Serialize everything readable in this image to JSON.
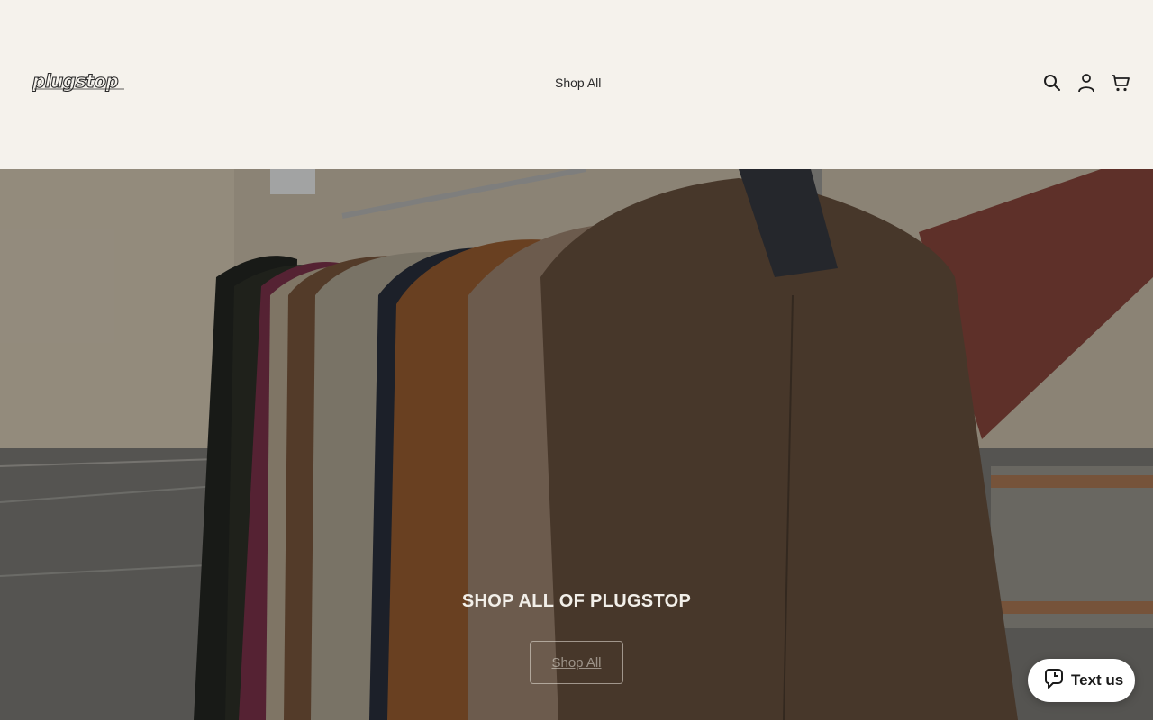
{
  "header": {
    "logo_text": "plugstop",
    "nav": [
      {
        "label": "Shop All"
      }
    ],
    "icons": [
      "search-icon",
      "account-icon",
      "cart-icon"
    ]
  },
  "hero": {
    "heading": "SHOP ALL OF PLUGSTOP",
    "button_label": "Shop All"
  },
  "chat_widget": {
    "label": "Text us",
    "icon": "chat-bubble-icon"
  },
  "colors": {
    "header_bg": "#f5f2ec",
    "text_dark": "#2a2a2a",
    "hero_text": "#f2efe9"
  }
}
